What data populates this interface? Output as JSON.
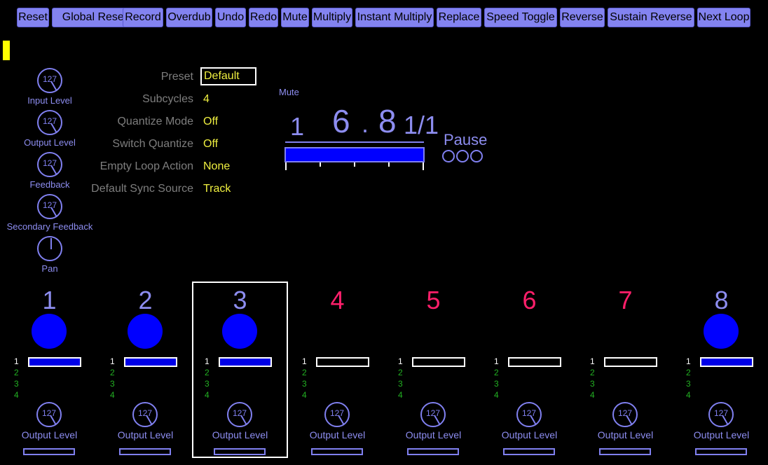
{
  "toolbar": {
    "buttons": [
      "Reset",
      "Global Reset",
      "Record",
      "Overdub",
      "Undo",
      "Redo",
      "Mute",
      "Multiply",
      "Instant Multiply",
      "Replace",
      "Speed Toggle",
      "Reverse",
      "Sustain Reverse",
      "Next Loop"
    ]
  },
  "knobs": [
    {
      "value": "127",
      "label": "Input Level"
    },
    {
      "value": "127",
      "label": "Output Level"
    },
    {
      "value": "127",
      "label": "Feedback"
    },
    {
      "value": "127",
      "label": "Secondary Feedback"
    },
    {
      "value": "",
      "label": "Pan"
    }
  ],
  "params": [
    {
      "label": "Preset",
      "value": "Default"
    },
    {
      "label": "Subcycles",
      "value": "4"
    },
    {
      "label": "Quantize Mode",
      "value": "Off"
    },
    {
      "label": "Switch Quantize",
      "value": "Off"
    },
    {
      "label": "Empty Loop Action",
      "value": "None"
    },
    {
      "label": "Default Sync Source",
      "value": "Track"
    }
  ],
  "loop_display": {
    "mode_label": "Mute",
    "loop_number": "1",
    "time_int": "6",
    "time_sep": ".",
    "time_dec": "8",
    "cycle": "1/1",
    "status": "Pause",
    "progress": 1.0
  },
  "tracks": [
    {
      "number": "1",
      "active": true,
      "loops": [
        "1",
        "2",
        "3",
        "4"
      ],
      "knob_value": "127",
      "knob_label": "Output Level"
    },
    {
      "number": "2",
      "active": true,
      "loops": [
        "1",
        "2",
        "3",
        "4"
      ],
      "knob_value": "127",
      "knob_label": "Output Level"
    },
    {
      "number": "3",
      "active": true,
      "selected": true,
      "loops": [
        "1",
        "2",
        "3",
        "4"
      ],
      "knob_value": "127",
      "knob_label": "Output Level"
    },
    {
      "number": "4",
      "active": false,
      "loops": [
        "1",
        "2",
        "3",
        "4"
      ],
      "knob_value": "127",
      "knob_label": "Output Level"
    },
    {
      "number": "5",
      "active": false,
      "loops": [
        "1",
        "2",
        "3",
        "4"
      ],
      "knob_value": "127",
      "knob_label": "Output Level"
    },
    {
      "number": "6",
      "active": false,
      "loops": [
        "1",
        "2",
        "3",
        "4"
      ],
      "knob_value": "127",
      "knob_label": "Output Level"
    },
    {
      "number": "7",
      "active": false,
      "loops": [
        "1",
        "2",
        "3",
        "4"
      ],
      "knob_value": "127",
      "knob_label": "Output Level"
    },
    {
      "number": "8",
      "active": true,
      "loops": [
        "1",
        "2",
        "3",
        "4"
      ],
      "knob_value": "127",
      "knob_label": "Output Level"
    }
  ],
  "colors": {
    "active_track": "#8d8df0",
    "inactive_track": "#ff1f6a",
    "loop_current": "#ffffff",
    "loop_other": "#22b022",
    "accent_yellow": "#f0f040"
  }
}
